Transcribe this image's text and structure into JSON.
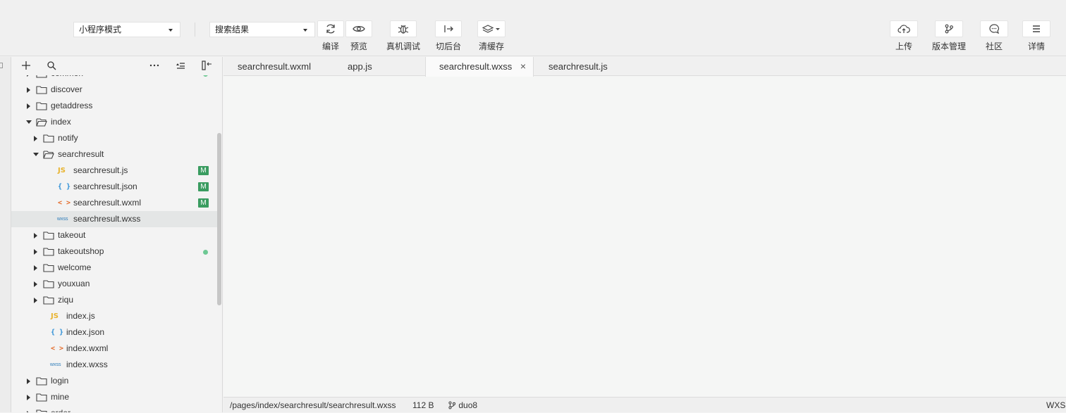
{
  "toolbar": {
    "mode_select": "小程序模式",
    "page_select": "搜索结果",
    "buttons": [
      {
        "label": "编译",
        "icon": "refresh-icon"
      },
      {
        "label": "预览",
        "icon": "eye-icon"
      },
      {
        "label": "真机调试",
        "icon": "bug-icon"
      },
      {
        "label": "切后台",
        "icon": "switch-background-icon"
      },
      {
        "label": "清缓存",
        "icon": "layers-icon"
      },
      {
        "label": "上传",
        "icon": "cloud-upload-icon"
      },
      {
        "label": "版本管理",
        "icon": "git-branch-icon"
      },
      {
        "label": "社区",
        "icon": "chat-bubble-icon"
      },
      {
        "label": "详情",
        "icon": "menu-icon"
      }
    ]
  },
  "explorer": {
    "header_icons": [
      "plus-icon",
      "search-icon",
      "more-icon",
      "collapse-all-icon",
      "toggle-panel-icon"
    ],
    "tree": [
      {
        "label": "common",
        "type": "folder",
        "depth": 0,
        "expanded": false,
        "status": "dot"
      },
      {
        "label": "discover",
        "type": "folder",
        "depth": 0,
        "expanded": false
      },
      {
        "label": "getaddress",
        "type": "folder",
        "depth": 0,
        "expanded": false
      },
      {
        "label": "index",
        "type": "folder",
        "depth": 0,
        "expanded": true
      },
      {
        "label": "notify",
        "type": "folder",
        "depth": 1,
        "expanded": false
      },
      {
        "label": "searchresult",
        "type": "folder",
        "depth": 1,
        "expanded": true
      },
      {
        "label": "searchresult.js",
        "type": "js",
        "depth": 2,
        "badge": "M"
      },
      {
        "label": "searchresult.json",
        "type": "json",
        "depth": 2,
        "badge": "M"
      },
      {
        "label": "searchresult.wxml",
        "type": "wxml",
        "depth": 2,
        "badge": "M"
      },
      {
        "label": "searchresult.wxss",
        "type": "wxss",
        "depth": 2,
        "selected": true
      },
      {
        "label": "takeout",
        "type": "folder",
        "depth": 1,
        "expanded": false
      },
      {
        "label": "takeoutshop",
        "type": "folder",
        "depth": 1,
        "expanded": false,
        "status": "dot"
      },
      {
        "label": "welcome",
        "type": "folder",
        "depth": 1,
        "expanded": false
      },
      {
        "label": "youxuan",
        "type": "folder",
        "depth": 1,
        "expanded": false
      },
      {
        "label": "ziqu",
        "type": "folder",
        "depth": 1,
        "expanded": false
      },
      {
        "label": "index.js",
        "type": "js",
        "depth": 1
      },
      {
        "label": "index.json",
        "type": "json",
        "depth": 1
      },
      {
        "label": "index.wxml",
        "type": "wxml",
        "depth": 1
      },
      {
        "label": "index.wxss",
        "type": "wxss",
        "depth": 1
      },
      {
        "label": "login",
        "type": "folder",
        "depth": 0,
        "expanded": false
      },
      {
        "label": "mine",
        "type": "folder",
        "depth": 0,
        "expanded": false
      },
      {
        "label": "order",
        "type": "folder",
        "depth": 0,
        "expanded": false
      }
    ],
    "file_icons": {
      "js": "JS",
      "json": "{ }",
      "wxml": "< >",
      "wxss": "wxss"
    }
  },
  "editor": {
    "tabs": [
      {
        "label": "searchresult.wxml"
      },
      {
        "label": "app.js"
      },
      {
        "label": "searchresult.wxss",
        "active": true
      },
      {
        "label": "searchresult.js"
      }
    ],
    "close_glyph": "×"
  },
  "status": {
    "path": "/pages/index/searchresult/searchresult.wxss",
    "size": "112 B",
    "branch": "duo8",
    "language": "WXSS"
  },
  "colors": {
    "badge_green": "#3a9c60",
    "dot_green": "#6dc893",
    "js_yellow": "#e8b32e",
    "json_blue": "#2d8fd6",
    "wxml_orange": "#e46c2c"
  }
}
